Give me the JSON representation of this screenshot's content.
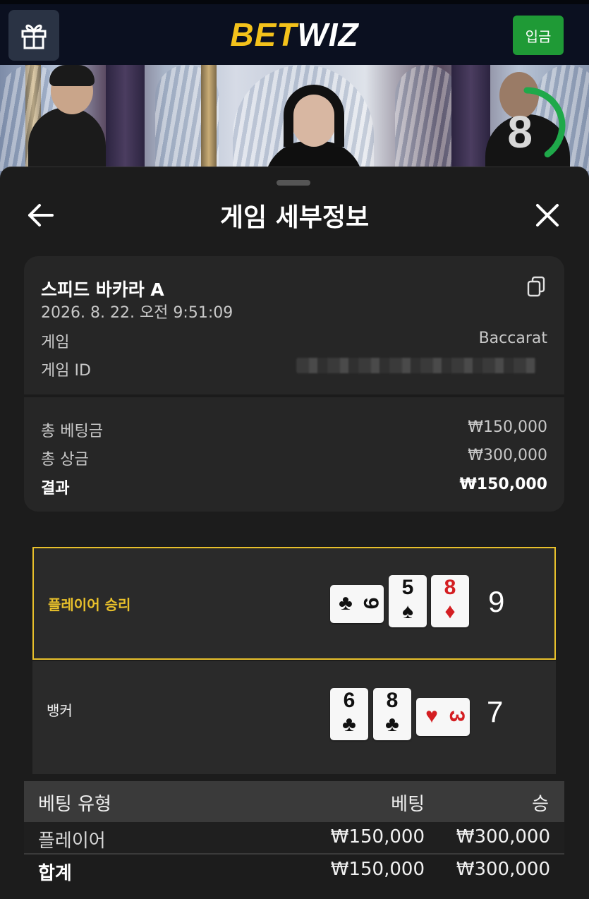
{
  "header": {
    "logo_part1": "BET",
    "logo_part2": "WIZ",
    "deposit_label": "입금"
  },
  "live": {
    "countdown": "8",
    "countdown_fraction": 0.4
  },
  "sheet": {
    "title": "게임 세부정보"
  },
  "details": {
    "game_name": "스피드 바카라 A",
    "datetime": "2026. 8. 22. 오전 9:51:09",
    "game_label": "게임",
    "game_value": "Baccarat",
    "game_id_label": "게임 ID",
    "total_bet_label": "총 베팅금",
    "total_bet_value": "₩150,000",
    "total_prize_label": "총 상금",
    "total_prize_value": "₩300,000",
    "result_label": "결과",
    "result_value": "₩150,000"
  },
  "result": {
    "player": {
      "label": "플레이어 승리",
      "score": "9",
      "cards": [
        {
          "rank": "9",
          "suit": "♣",
          "color": "black",
          "orientation": "sideways"
        },
        {
          "rank": "5",
          "suit": "♠",
          "color": "black",
          "orientation": "upright"
        },
        {
          "rank": "8",
          "suit": "♦",
          "color": "red",
          "orientation": "upright"
        }
      ]
    },
    "banker": {
      "label": "뱅커",
      "score": "7",
      "cards": [
        {
          "rank": "6",
          "suit": "♣",
          "color": "black",
          "orientation": "upright"
        },
        {
          "rank": "8",
          "suit": "♣",
          "color": "black",
          "orientation": "upright"
        },
        {
          "rank": "3",
          "suit": "♥",
          "color": "red",
          "orientation": "sideways"
        }
      ]
    }
  },
  "table": {
    "headers": {
      "type": "베팅 유형",
      "bet": "베팅",
      "win": "승"
    },
    "rows": [
      {
        "type": "플레이어",
        "bet": "₩150,000",
        "win": "₩300,000"
      }
    ],
    "total": {
      "type": "합계",
      "bet": "₩150,000",
      "win": "₩300,000"
    }
  },
  "colors": {
    "brand_yellow": "#f4c21b",
    "deposit_green": "#1f9a36",
    "win_border": "#e8c02b",
    "card_red": "#d41e22"
  }
}
